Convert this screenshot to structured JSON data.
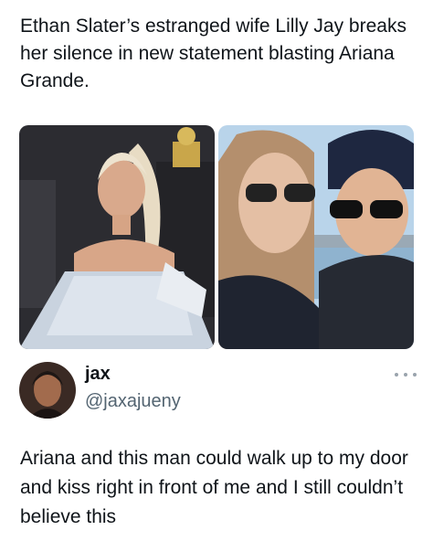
{
  "post": {
    "headline": "Ethan Slater’s estranged wife Lilly Jay breaks her silence in new statement blasting Ariana Grande."
  },
  "media": {
    "left_photo_icon": "photo-ariana-red-carpet",
    "right_photo_icon": "photo-couple-selfie"
  },
  "quote": {
    "author_name": "jax",
    "author_handle": "@jaxajueny",
    "text": "Ariana and this man could walk up to my door and kiss right in front of me and I still couldn’t believe this",
    "more_icon": "more-options-icon"
  },
  "colors": {
    "text": "#0f1419",
    "secondary_text": "#536471",
    "background": "#ffffff"
  }
}
